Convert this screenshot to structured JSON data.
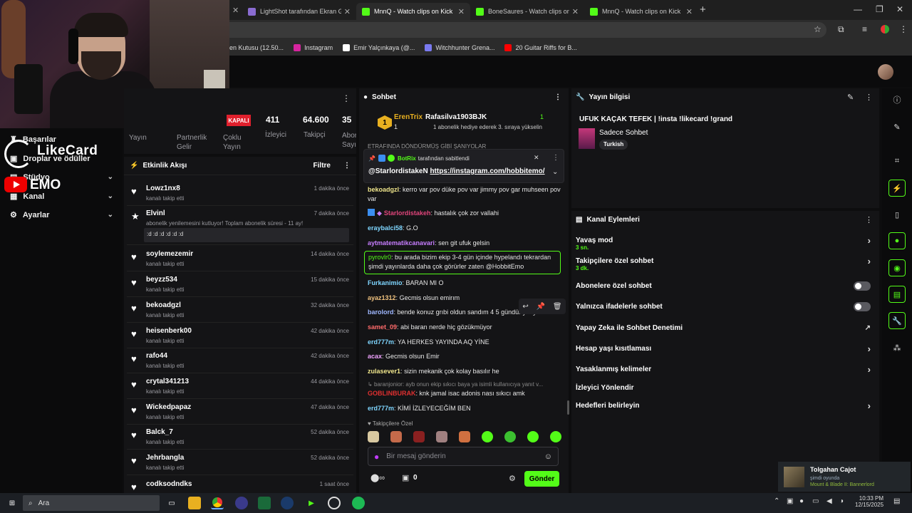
{
  "browser": {
    "tabs": [
      {
        "title": "LightShot tarafından Ekran Gör",
        "color": "#8a6cd1"
      },
      {
        "title": "MnnQ - Watch clips on Kick",
        "color": "#53fc18"
      },
      {
        "title": "BoneSaures - Watch clips on Ki",
        "color": "#53fc18"
      },
      {
        "title": "MnnQ - Watch clips on Kick",
        "color": "#53fc18"
      }
    ],
    "new_tab": "+",
    "bookmarks": [
      {
        "label": "len Kutusu (12.50...",
        "color": "#d93025"
      },
      {
        "label": "Instagram",
        "color": "#d6249f"
      },
      {
        "label": "Emir Yalçınkaya (@...",
        "color": "#ffffff"
      },
      {
        "label": "Witchhunter Grena...",
        "color": "#7a7af0"
      },
      {
        "label": "20 Guitar Riffs for B...",
        "color": "#ff0000"
      }
    ]
  },
  "overlay": {
    "brand": "LikeCard",
    "emo": "EMO"
  },
  "left_nav": {
    "items": [
      {
        "label": "Başarılar",
        "icon": "trophy-icon"
      },
      {
        "label": "Droplar ve ödüller",
        "icon": "gift-icon"
      },
      {
        "label": "Stüdyo",
        "icon": "studio-icon"
      },
      {
        "label": "Kanal",
        "icon": "channel-icon"
      },
      {
        "label": "Ayarlar",
        "icon": "gear-icon"
      }
    ]
  },
  "stats": {
    "status": "KAPALI",
    "viewers": "411",
    "viewers_label": "İzleyici",
    "followers": "64.600",
    "followers_label": "Takipçi",
    "subs": "35",
    "subs_label": "Abon Sayıs",
    "tabs": [
      "Yayın",
      "Partnerlik Gelir",
      "Çoklu Yayın"
    ]
  },
  "activity": {
    "title": "Etkinlik Akışı",
    "filter": "Filtre",
    "events": [
      {
        "name": "Lowz1nx8",
        "sub": "kanalı takip etti",
        "time": "1 dakika önce"
      },
      {
        "name": "Elvinl",
        "sub": "abonelik yenilemesini kutluyor! Toplam abonelik süresi - 11 ay!",
        "time": "7 dakika önce",
        "note": ":d :d :d :d :d :d"
      },
      {
        "name": "soylemezemir",
        "sub": "kanalı takip etti",
        "time": "14 dakika önce"
      },
      {
        "name": "beyzz534",
        "sub": "kanalı takip etti",
        "time": "15 dakika önce"
      },
      {
        "name": "bekoadgzl",
        "sub": "kanalı takip etti",
        "time": "32 dakika önce"
      },
      {
        "name": "heisenberk00",
        "sub": "kanalı takip etti",
        "time": "42 dakika önce"
      },
      {
        "name": "rafo44",
        "sub": "kanalı takip etti",
        "time": "42 dakika önce"
      },
      {
        "name": "crytal341213",
        "sub": "kanalı takip etti",
        "time": "44 dakika önce"
      },
      {
        "name": "Wickedpapaz",
        "sub": "kanalı takip etti",
        "time": "47 dakika önce"
      },
      {
        "name": "Balck_7",
        "sub": "kanalı takip etti",
        "time": "52 dakika önce"
      },
      {
        "name": "Jehrbangla",
        "sub": "kanalı takip etti",
        "time": "52 dakika önce"
      },
      {
        "name": "codksodndks",
        "sub": "",
        "time": "1 saat önce"
      }
    ]
  },
  "chat": {
    "title": "Sohbet",
    "gift_user1": "ErenTrix",
    "gift_count1": "1",
    "gift_user2": "Rafasilva1903BJK",
    "gift_count2": "1",
    "gift_text": "1 abonelik hediye ederek 3. sıraya yükselin",
    "cut_text": "ETRAFINDA DÖNDÜRMÜŞ GİBİ ŞANIYOLAR",
    "pinned_by": "BotRix",
    "pinned_label": "tarafından sabitlendi",
    "pinned_mention": "@StarlordistakeN",
    "pinned_link": "https://instagram.com/hobbitemo/",
    "messages": [
      {
        "user": "bekoadgzl",
        "color": "#f0e68c",
        "text": "kerro var pov düke pov var jimmy pov gar muhseen pov var"
      },
      {
        "user": "Starlordistakeh",
        "color": "#e0457b",
        "text": "hastalık çok zor vallahi"
      },
      {
        "user": "eraybalci58",
        "color": "#7fd6ff",
        "text": "G.O"
      },
      {
        "user": "aytmatematikcanavari",
        "color": "#c77dff",
        "text": "sen git ufuk gelsin"
      },
      {
        "user": "pyrovlr0",
        "color": "#53fc18",
        "text": "bu arada bizim ekip 3-4 gün içinde hypelandı tekrardan şimdi yayınlarda daha çok görürler zaten @HobbitEmo"
      },
      {
        "user": "Furkanimio",
        "color": "#7fd6ff",
        "text": "BARAN MI O"
      },
      {
        "user": "ayaz1312",
        "color": "#f0c27f",
        "text": "Gecmis olsun emirım"
      },
      {
        "user": "barolord",
        "color": "#9fb7ff",
        "text": "bende konuz grıbi oldun sandım 4 5 gündür yatıyom"
      },
      {
        "user": "samet_09",
        "color": "#ff6b6b",
        "text": "abi baran nerde hiç gözükmüyor"
      },
      {
        "user": "erd777m",
        "color": "#7fd6ff",
        "text": "YA HERKES YAYINDA AQ YİNE"
      },
      {
        "user": "acax",
        "color": "#f0a3ff",
        "text": "Gecmis olsun Emir"
      },
      {
        "user": "zulasever1",
        "color": "#f0e68c",
        "text": "sizin mekanik çok kolay basılır he"
      },
      {
        "user": "GOBLINBURAK",
        "color": "#e03030",
        "text": "knk jamal isac adonis nası sıkıcı amk"
      },
      {
        "user": "erd777m",
        "color": "#7fd6ff",
        "text": "KİMİ İZLEYECEĞİM BEN"
      }
    ],
    "reply_text": "baranjonior: ayb onun ekip sıkıcı baya ya isimli kullanıcıya yanıt v...",
    "followers_only": "Takipçilere Özel",
    "input_placeholder": "Bir mesaj gönderin",
    "points": "0",
    "send": "Gönder"
  },
  "stream_info": {
    "title": "Yayın bilgisi",
    "stream_title": "UFUK KAÇAK TEFEK | !insta !likecard !grand",
    "category": "Sadece Sohbet",
    "tag": "Turkish"
  },
  "channel_actions": {
    "title": "Kanal Eylemleri",
    "rows": [
      {
        "label": "Yavaş mod",
        "sub": "3 sn.",
        "control": "arrow"
      },
      {
        "label": "Takipçilere özel sohbet",
        "sub": "3 dk.",
        "control": "arrow"
      },
      {
        "label": "Abonelere özel sohbet",
        "sub": "",
        "control": "toggle"
      },
      {
        "label": "Yalnızca ifadelerle sohbet",
        "sub": "",
        "control": "toggle"
      },
      {
        "label": "Yapay Zeka ile Sohbet Denetimi",
        "sub": "",
        "control": "external"
      },
      {
        "label": "Hesap yaşı kısıtlaması",
        "sub": "",
        "control": "arrow"
      },
      {
        "label": "Yasaklanmış kelimeler",
        "sub": "",
        "control": "arrow"
      },
      {
        "label": "İzleyici Yönlendir",
        "sub": "",
        "control": "none"
      },
      {
        "label": "Hedefleri belirleyin",
        "sub": "",
        "control": "arrow"
      }
    ]
  },
  "notification": {
    "name": "Tolgahan Cajot",
    "status": "şimdi oyunda",
    "game": "Mount & Blade II: Bannerlord"
  },
  "taskbar": {
    "search": "Ara",
    "time": "10:33 PM",
    "date": "12/15/2025"
  }
}
